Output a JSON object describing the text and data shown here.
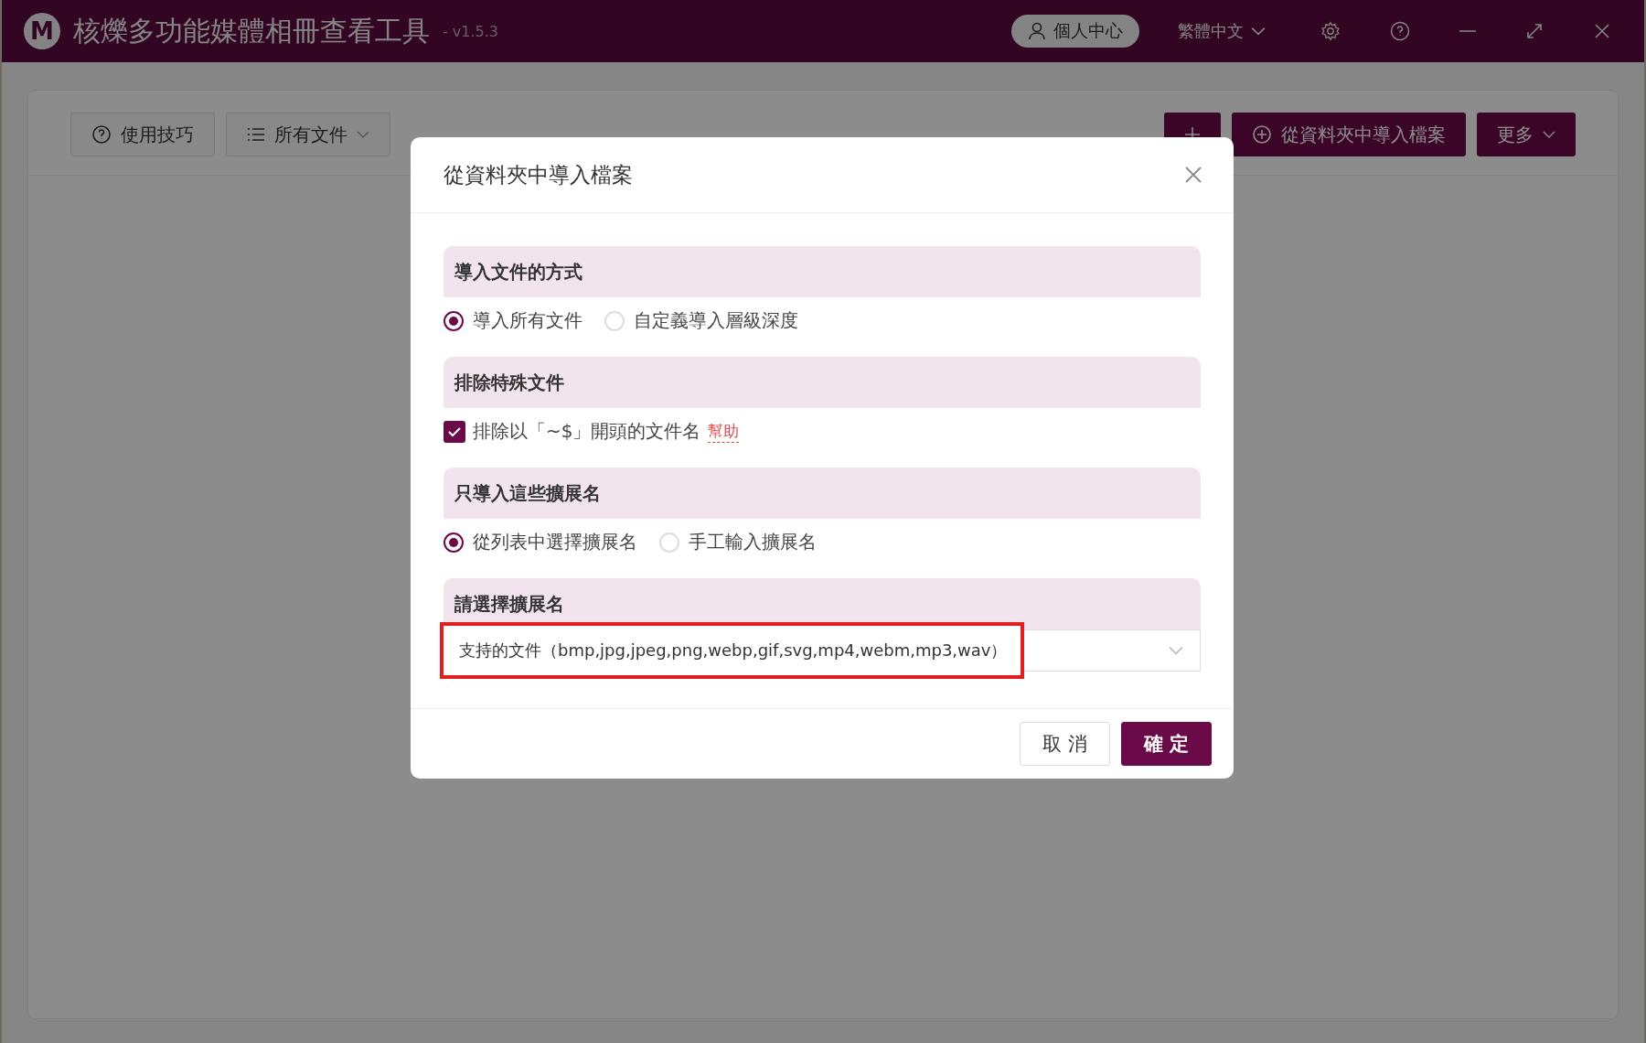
{
  "app": {
    "logo": "M",
    "title": "核爍多功能媒體相冊查看工具",
    "version": "- v1.5.3",
    "user_button": "個人中心",
    "language": "繁體中文"
  },
  "toolbar": {
    "left": [
      {
        "kind": "help",
        "label": "使用技巧"
      },
      {
        "kind": "filter",
        "label": "所有文件"
      }
    ],
    "right": [
      {
        "kind": "add"
      },
      {
        "kind": "import",
        "label": "從資料夾中導入檔案"
      },
      {
        "kind": "more",
        "label": "更多"
      }
    ]
  },
  "dialog": {
    "title": "從資料夾中導入檔案",
    "sections": [
      {
        "heading": "導入文件的方式",
        "kind": "radio",
        "options": [
          {
            "label": "導入所有文件",
            "selected": true
          },
          {
            "label": "自定義導入層級深度",
            "selected": false
          }
        ]
      },
      {
        "heading": "排除特殊文件",
        "kind": "checkbox",
        "options": [
          {
            "label": "排除以「~$」開頭的文件名",
            "checked": true,
            "link": "幫助"
          }
        ]
      },
      {
        "heading": "只導入這些擴展名",
        "kind": "radio",
        "options": [
          {
            "label": "從列表中選擇擴展名",
            "selected": true
          },
          {
            "label": "手工輸入擴展名",
            "selected": false
          }
        ]
      },
      {
        "heading": "請選擇擴展名",
        "kind": "select",
        "value": "支持的文件（bmp,jpg,jpeg,png,webp,gif,svg,mp4,webm,mp3,wav）",
        "highlighted": true
      }
    ],
    "buttons": [
      {
        "kind": "secondary",
        "label": "取 消"
      },
      {
        "kind": "primary",
        "label": "確 定"
      }
    ]
  }
}
